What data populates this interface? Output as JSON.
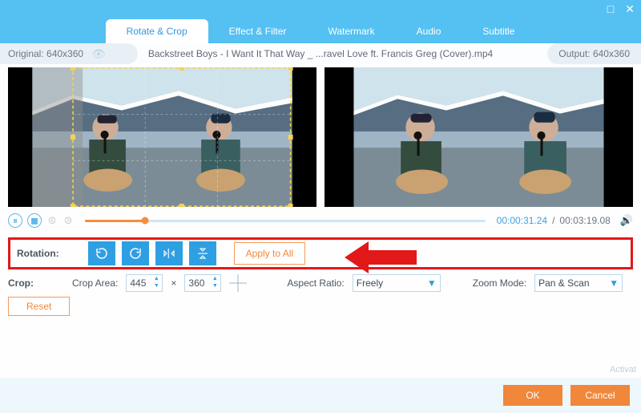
{
  "window": {
    "minimize": "—",
    "maximize": "□",
    "close": "✕"
  },
  "tabs": [
    "Rotate & Crop",
    "Effect & Filter",
    "Watermark",
    "Audio",
    "Subtitle"
  ],
  "activeTab": 0,
  "info": {
    "originalLabel": "Original: 640x360",
    "fileName": "Backstreet Boys - I Want It That Way _ ...ravel Love ft. Francis Greg (Cover).mp4",
    "outputLabel": "Output: 640x360"
  },
  "player": {
    "currentTime": "00:00:31.24",
    "totalTime": "00:03:19.08",
    "sep": "/"
  },
  "rotation": {
    "label": "Rotation:",
    "applyAll": "Apply to All",
    "icons": [
      "rotate-left-icon",
      "rotate-right-icon",
      "flip-horizontal-icon",
      "flip-vertical-icon"
    ]
  },
  "crop": {
    "label": "Crop:",
    "areaLabel": "Crop Area:",
    "w": "445",
    "sep": "×",
    "h": "360",
    "aspectLabel": "Aspect Ratio:",
    "aspectValue": "Freely",
    "zoomLabel": "Zoom Mode:",
    "zoomValue": "Pan & Scan",
    "reset": "Reset"
  },
  "footer": {
    "ok": "OK",
    "cancel": "Cancel"
  },
  "hint": "Activat"
}
